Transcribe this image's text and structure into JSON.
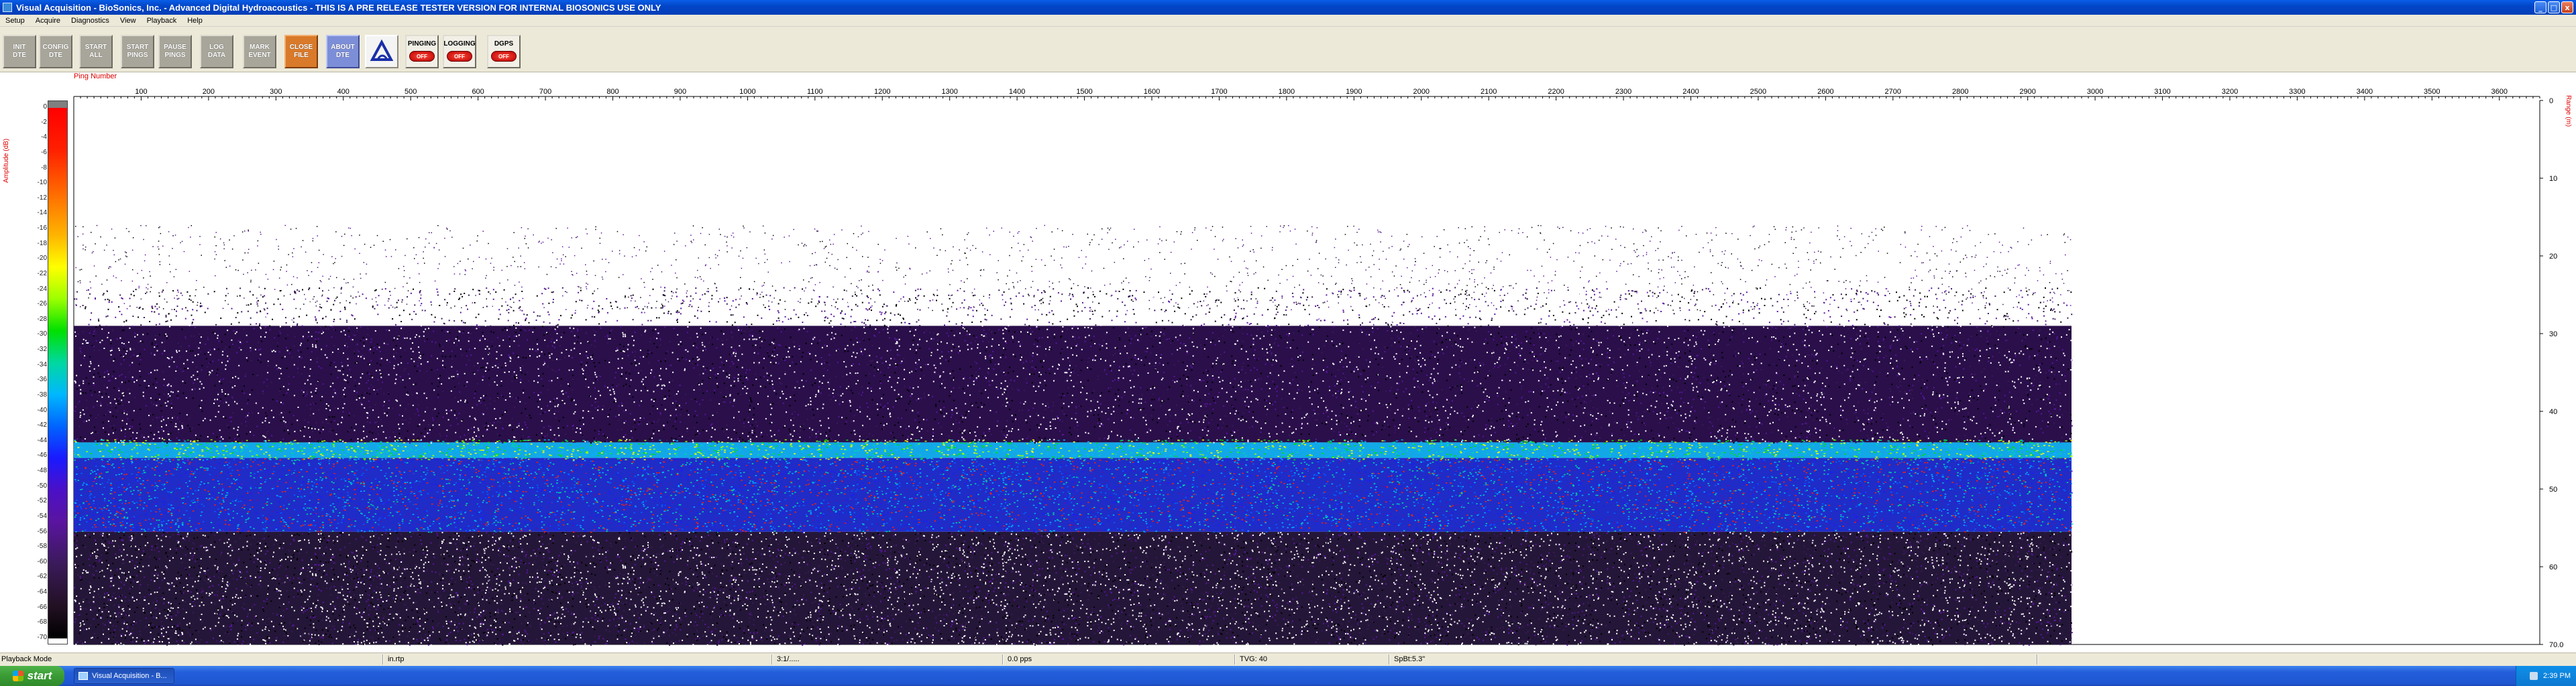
{
  "window": {
    "title": "Visual Acquisition  -  BioSonics, Inc.  -  Advanced Digital Hydroacoustics  -  THIS IS A PRE RELEASE TESTER VERSION FOR INTERNAL BIOSONICS USE ONLY",
    "minimize": "_",
    "maximize": "□",
    "close": "x"
  },
  "menu": [
    "Setup",
    "Acquire",
    "Diagnostics",
    "View",
    "Playback",
    "Help"
  ],
  "toolbar": {
    "init_dte": "INIT\nDTE",
    "config_dte": "CONFIG\nDTE",
    "start_all": "START\nALL",
    "start_pings": "START\nPINGS",
    "pause_pings": "PAUSE\nPINGS",
    "log_data": "LOG\nDATA",
    "mark_event": "MARK\nEVENT",
    "close_file": "CLOSE\nFILE",
    "about_dte": "ABOUT\nDTE",
    "pinging_title": "PINGING",
    "pinging_state": "OFF",
    "logging_title": "LOGGING",
    "logging_state": "OFF",
    "dgps_title": "DGPS",
    "dgps_state": "OFF"
  },
  "plot": {
    "ping_axis_label": "Ping Number",
    "amplitude_axis_label": "Amplitude (dB)",
    "range_axis_label": "Range (m)",
    "range_bottom_value": "70.0"
  },
  "chart_data": {
    "type": "heatmap",
    "title": "",
    "xlabel": "Ping Number",
    "ylabel": "Range (m)",
    "colorbar_label": "Amplitude (dB)",
    "x_ticks": [
      100,
      200,
      300,
      400,
      500,
      600,
      700,
      800,
      900,
      1000,
      1100,
      1200,
      1300,
      1400,
      1500,
      1600,
      1700,
      1800,
      1900,
      2000,
      2100,
      2200,
      2300,
      2400,
      2500,
      2600,
      2700,
      2800,
      2900,
      3000,
      3100,
      3200,
      3300,
      3400,
      3500,
      3600
    ],
    "xlim": [
      0,
      3660
    ],
    "range_ticks": [
      0,
      10,
      20,
      30,
      40,
      50,
      60,
      70
    ],
    "ylim": [
      0,
      70
    ],
    "amplitude_ticks": [
      0,
      -2,
      -4,
      -6,
      -8,
      -10,
      -12,
      -14,
      -16,
      -18,
      -20,
      -22,
      -24,
      -26,
      -28,
      -30,
      -32,
      -34,
      -36,
      -38,
      -40,
      -42,
      -44,
      -46,
      -48,
      -50,
      -52,
      -54,
      -56,
      -58,
      -60,
      -62,
      -64,
      -66,
      -68,
      -70
    ],
    "amplitude_range": [
      0,
      -70
    ],
    "data_extent_pings": [
      0,
      2965
    ],
    "layers": [
      {
        "name": "sparse noise",
        "range_m": [
          17,
          27
        ],
        "level_db": -66
      },
      {
        "name": "volume backscatter",
        "range_m": [
          27,
          44
        ],
        "level_db": -62
      },
      {
        "name": "strong layer",
        "range_m": [
          44,
          46
        ],
        "level_db": -44
      },
      {
        "name": "scattering band",
        "range_m": [
          46,
          55.5
        ],
        "level_db": -50
      },
      {
        "name": "deep noise",
        "range_m": [
          55.5,
          70
        ],
        "level_db": -65
      }
    ]
  },
  "status": {
    "mode": "Playback Mode",
    "file": "in.rtp",
    "time": "3:1/.....",
    "rate": "0.0 pps",
    "tvg": "TVG: 40",
    "spl": "SpBt:5.3\"",
    "extra": ""
  },
  "taskbar": {
    "start": "start",
    "task": "Visual Acquisition - B...",
    "clock": "2:39 PM"
  }
}
